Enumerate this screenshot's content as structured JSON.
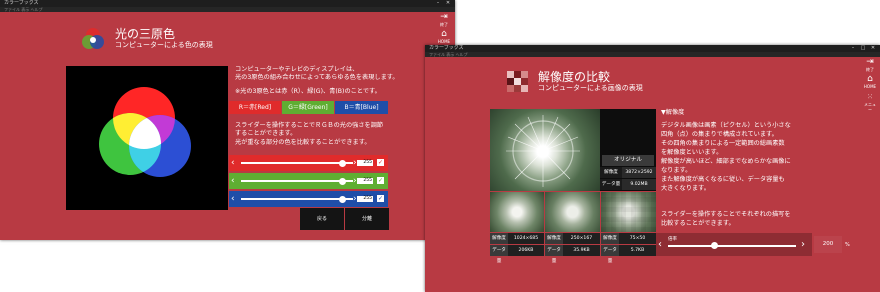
{
  "left": {
    "window_title": "カラーブックス",
    "menu_text": "ファイル 表示 ヘルプ",
    "title": "光の三原色",
    "subtitle": "コンピューターによる色の表現",
    "tool_exit": "終了",
    "tool_home": "HOME",
    "intro": [
      "コンピューターやテレビのディスプレイは、",
      "光の3原色の組み合わせによってあらゆる色を表現します。"
    ],
    "primaries_note": "※光の3原色とは赤（R）、緑(G)、青(B)のことです。",
    "chips": [
      {
        "label": "R＝赤[Red]",
        "color": "#e02b2b"
      },
      {
        "label": "G＝緑[Green]",
        "color": "#5fae32"
      },
      {
        "label": "B＝青[Blue]",
        "color": "#1f4ea8"
      }
    ],
    "instruction": [
      "スライダーを操作することでＲＧＢの光の強さを調節",
      "することができます。",
      "光が重なる部分の色を比較することができます。"
    ],
    "sliders": [
      {
        "value": "255",
        "level": 0.95,
        "color": "#e02b2b"
      },
      {
        "value": "255",
        "level": 0.95,
        "color": "#5fae32"
      },
      {
        "value": "255",
        "level": 0.95,
        "color": "#1f4ea8"
      }
    ],
    "btn_reset": "戻る",
    "btn_separate": "分離"
  },
  "right": {
    "window_title": "カラーブックス",
    "menu_text": "ファイル 表示 ヘルプ",
    "title": "解像度の比較",
    "subtitle": "コンピューターによる画像の表現",
    "tool_exit": "終了",
    "tool_home": "HOME",
    "tool_menu": "メニュー",
    "section_heading": "▼解像度",
    "body": [
      "デジタル画像は画素（ピクセル）という小さな",
      "四角（点）の集まりで構成されています。",
      "その四角の集まりによる一定範囲の総画素数",
      "を解像度といいます。",
      "解像度が高いほど、細部までなめらかな画像に",
      "なります。",
      "また解像度が高くなるに従い、データ容量も",
      "大きくなります。"
    ],
    "instruction": [
      "スライダーを操作することでそれぞれの描写を",
      "比較することができます。"
    ],
    "original_label": "オリジナル",
    "original_rows": [
      {
        "k": "解像度",
        "v": "3872×2592"
      },
      {
        "k": "データ量",
        "v": "9.02MB"
      }
    ],
    "thumb_rows": [
      {
        "res_k": "解像度",
        "res_v": "1024×685",
        "size_k": "データ量",
        "size_v": "206KB"
      },
      {
        "res_k": "解像度",
        "res_v": "250×167",
        "size_k": "データ量",
        "size_v": "35.9KB"
      },
      {
        "res_k": "解像度",
        "res_v": "75×50",
        "size_k": "データ量",
        "size_v": "5.7KB"
      }
    ],
    "zoom_label": "倍率",
    "zoom_value": "200",
    "zoom_unit": "%",
    "zoom_level": 0.3
  }
}
